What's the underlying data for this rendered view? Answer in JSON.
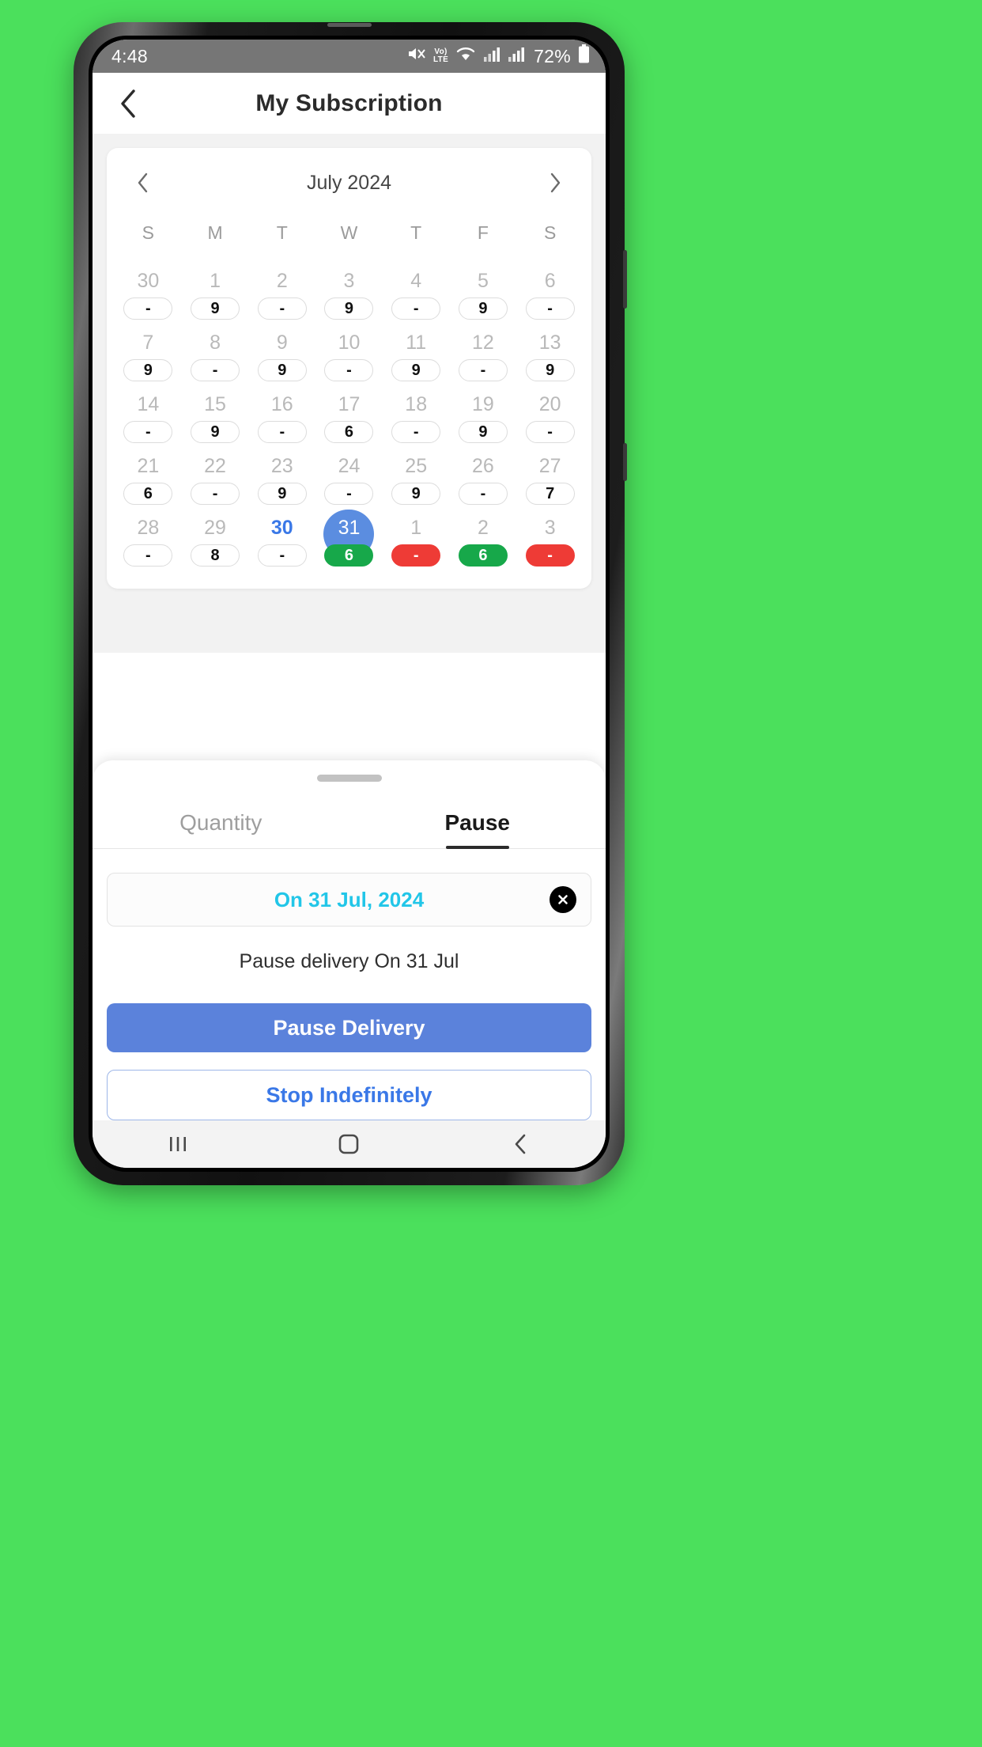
{
  "statusbar": {
    "time": "4:48",
    "battery_percent": "72%",
    "icons": [
      "mute-icon",
      "volte-icon",
      "wifi-icon",
      "signal-icon",
      "signal-icon",
      "battery-icon"
    ],
    "volte_top": "Vo)",
    "volte_bottom": "LTE",
    "background": "#767676"
  },
  "header": {
    "title": "My Subscription",
    "back_icon": "chevron-left-icon"
  },
  "calendar": {
    "month_label": "July 2024",
    "prev_icon": "chevron-left-icon",
    "next_icon": "chevron-right-icon",
    "weekdays": [
      "S",
      "M",
      "T",
      "W",
      "T",
      "F",
      "S"
    ],
    "weeks": [
      [
        {
          "day": "30",
          "qty": "-",
          "muted": true,
          "style": "plain"
        },
        {
          "day": "1",
          "qty": "9",
          "muted": true,
          "style": "plain"
        },
        {
          "day": "2",
          "qty": "-",
          "muted": true,
          "style": "plain"
        },
        {
          "day": "3",
          "qty": "9",
          "muted": true,
          "style": "plain"
        },
        {
          "day": "4",
          "qty": "-",
          "muted": true,
          "style": "plain"
        },
        {
          "day": "5",
          "qty": "9",
          "muted": true,
          "style": "plain"
        },
        {
          "day": "6",
          "qty": "-",
          "muted": true,
          "style": "plain"
        }
      ],
      [
        {
          "day": "7",
          "qty": "9",
          "muted": true,
          "style": "plain"
        },
        {
          "day": "8",
          "qty": "-",
          "muted": true,
          "style": "plain"
        },
        {
          "day": "9",
          "qty": "9",
          "muted": true,
          "style": "plain"
        },
        {
          "day": "10",
          "qty": "-",
          "muted": true,
          "style": "plain"
        },
        {
          "day": "11",
          "qty": "9",
          "muted": true,
          "style": "plain"
        },
        {
          "day": "12",
          "qty": "-",
          "muted": true,
          "style": "plain"
        },
        {
          "day": "13",
          "qty": "9",
          "muted": true,
          "style": "plain"
        }
      ],
      [
        {
          "day": "14",
          "qty": "-",
          "muted": true,
          "style": "plain"
        },
        {
          "day": "15",
          "qty": "9",
          "muted": true,
          "style": "plain"
        },
        {
          "day": "16",
          "qty": "-",
          "muted": true,
          "style": "plain"
        },
        {
          "day": "17",
          "qty": "6",
          "muted": true,
          "style": "plain"
        },
        {
          "day": "18",
          "qty": "-",
          "muted": true,
          "style": "plain"
        },
        {
          "day": "19",
          "qty": "9",
          "muted": true,
          "style": "plain"
        },
        {
          "day": "20",
          "qty": "-",
          "muted": true,
          "style": "plain"
        }
      ],
      [
        {
          "day": "21",
          "qty": "6",
          "muted": true,
          "style": "plain"
        },
        {
          "day": "22",
          "qty": "-",
          "muted": true,
          "style": "plain"
        },
        {
          "day": "23",
          "qty": "9",
          "muted": true,
          "style": "plain"
        },
        {
          "day": "24",
          "qty": "-",
          "muted": true,
          "style": "plain"
        },
        {
          "day": "25",
          "qty": "9",
          "muted": true,
          "style": "plain"
        },
        {
          "day": "26",
          "qty": "-",
          "muted": true,
          "style": "plain"
        },
        {
          "day": "27",
          "qty": "7",
          "muted": true,
          "style": "plain"
        }
      ],
      [
        {
          "day": "28",
          "qty": "-",
          "muted": true,
          "style": "plain"
        },
        {
          "day": "29",
          "qty": "8",
          "muted": true,
          "style": "plain"
        },
        {
          "day": "30",
          "qty": "-",
          "muted": false,
          "style": "plain",
          "today": true
        },
        {
          "day": "31",
          "qty": "6",
          "muted": false,
          "style": "green",
          "selected": true
        },
        {
          "day": "1",
          "qty": "-",
          "muted": true,
          "style": "red"
        },
        {
          "day": "2",
          "qty": "6",
          "muted": true,
          "style": "green"
        },
        {
          "day": "3",
          "qty": "-",
          "muted": true,
          "style": "red"
        }
      ]
    ],
    "colors": {
      "selected": "#5B8DE0",
      "green": "#17A84A",
      "red": "#EE3B36",
      "today_text": "#3A78E7"
    }
  },
  "sheet": {
    "tabs": [
      {
        "label": "Quantity",
        "active": false
      },
      {
        "label": "Pause",
        "active": true
      }
    ],
    "selected_date_label": "On 31 Jul, 2024",
    "clear_icon": "close-circle-icon",
    "note": "Pause delivery On 31 Jul",
    "primary_button": "Pause Delivery",
    "secondary_button": "Stop Indefinitely",
    "colors": {
      "date_text": "#22C6E8",
      "primary_bg": "#5B82DB",
      "secondary_text": "#3A78E7"
    }
  },
  "navbar": {
    "recents_icon": "recents-icon",
    "home_icon": "home-icon",
    "back_icon": "back-icon"
  }
}
